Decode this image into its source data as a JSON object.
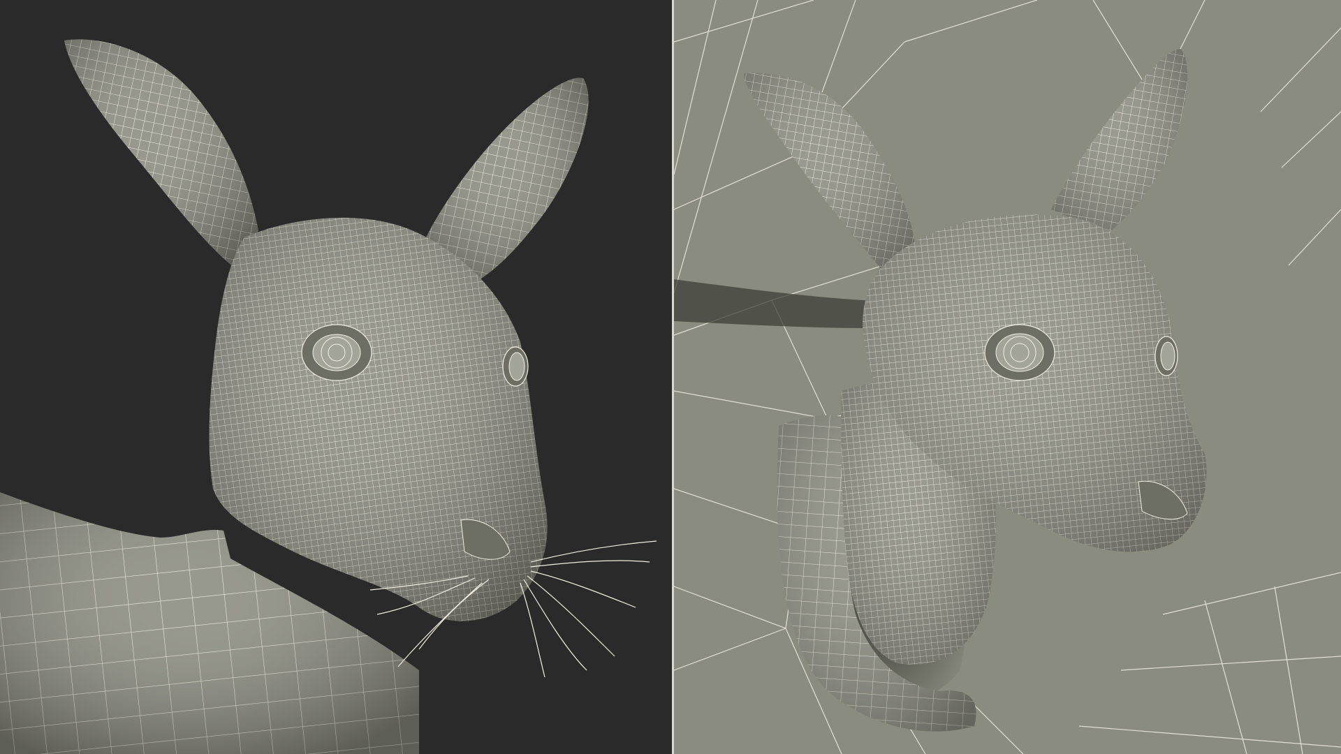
{
  "colors": {
    "left_background": "#2a2a2a",
    "right_background": "#8b8c80",
    "mesh_fill": "#8f9084",
    "mesh_fill_dark": "#6e6f64",
    "mesh_fill_light": "#a4a599",
    "wire": "#f2efe2",
    "divider": "#d8d8d0",
    "shadow": "#3c3d36"
  },
  "panels": [
    {
      "subject": "kangaroo-head-wireframe-with-whiskers",
      "background": "dark"
    },
    {
      "subject": "kangaroo-head-in-pouch-wireframe",
      "background": "mesh-environment"
    }
  ]
}
